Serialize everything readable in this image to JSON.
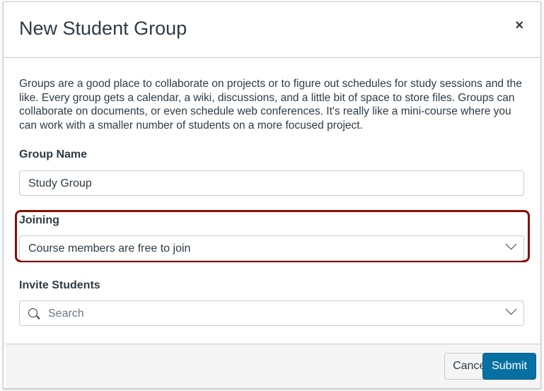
{
  "dialog": {
    "title": "New Student Group",
    "close_label": "×",
    "description": "Groups are a good place to collaborate on projects or to figure out schedules for study sessions and the like. Every group gets a calendar, a wiki, discussions, and a little bit of space to store files. Groups can collaborate on documents, or even schedule web conferences. It's really like a mini-course where you can work with a smaller number of students on a more focused project.",
    "group_name": {
      "label": "Group Name",
      "value": "Study Group"
    },
    "joining": {
      "label": "Joining",
      "selected": "Course members are free to join"
    },
    "invite": {
      "label": "Invite Students",
      "placeholder": "Search"
    },
    "buttons": {
      "cancel": "Cancel",
      "submit": "Submit"
    }
  },
  "colors": {
    "highlight": "#8b0b0b",
    "primary": "#0770a3"
  }
}
